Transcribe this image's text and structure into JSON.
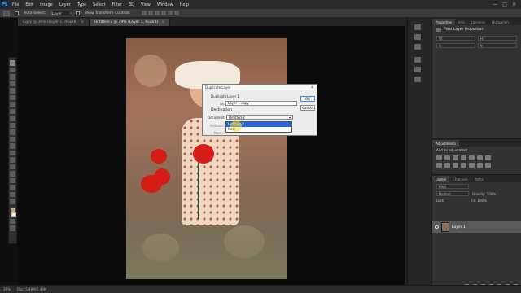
{
  "app": {
    "logo": "Ps"
  },
  "menu": [
    "File",
    "Edit",
    "Image",
    "Layer",
    "Type",
    "Select",
    "Filter",
    "3D",
    "View",
    "Window",
    "Help"
  ],
  "window_controls": [
    "—",
    "□",
    "✕"
  ],
  "options_bar": {
    "auto_select_label": "Auto-Select:",
    "layer_select": "Layer",
    "show_transform_label": "Show Transform Controls"
  },
  "tabs": [
    {
      "label": "Cgsy @ 39% (Layer 1, RGB/8)",
      "close": "×"
    },
    {
      "label": "Untitled-2 @ 39% (Layer 1, RGB/8)",
      "close": "×"
    }
  ],
  "dialog": {
    "title": "Duplicate Layer",
    "close": "✕",
    "duplicate_label": "Duplicate:",
    "duplicate_value": "Layer 1",
    "as_label": "As:",
    "as_value": "Layer 1 copy",
    "destination_label": "Destination",
    "document_label": "Document:",
    "document_value": "Untitled-2",
    "artboard_label": "Artboard:",
    "name_label": "Name:",
    "ok_label": "OK",
    "cancel_label": "Cancel",
    "dropdown_options": [
      "Untitled-2",
      "New"
    ]
  },
  "right_panel": {
    "tabs": [
      "Properties",
      "Info",
      "Libraries",
      "Histogram"
    ],
    "heading": "Pixel Layer Properties",
    "fields": [
      "W:",
      "H:",
      "X:",
      "Y:"
    ],
    "adjustments_tab": "Adjustments",
    "adjustments_sub": "Add an adjustment",
    "layers_tabs": [
      "Layers",
      "Channels",
      "Paths"
    ],
    "kind_label": "Kind",
    "blend_mode": "Normal",
    "opacity_label": "Opacity: 100%",
    "lock_label": "Lock:",
    "fill_label": "Fill: 100%",
    "layer_name": "Layer 1"
  },
  "status": {
    "zoom": "39%",
    "doc": "Doc: 5.49M/5.49M"
  },
  "colors": {
    "accent": "#2b63d9",
    "foreground": "#d2a25a",
    "background": "#f2f2f2",
    "rose": "#d51c17"
  }
}
